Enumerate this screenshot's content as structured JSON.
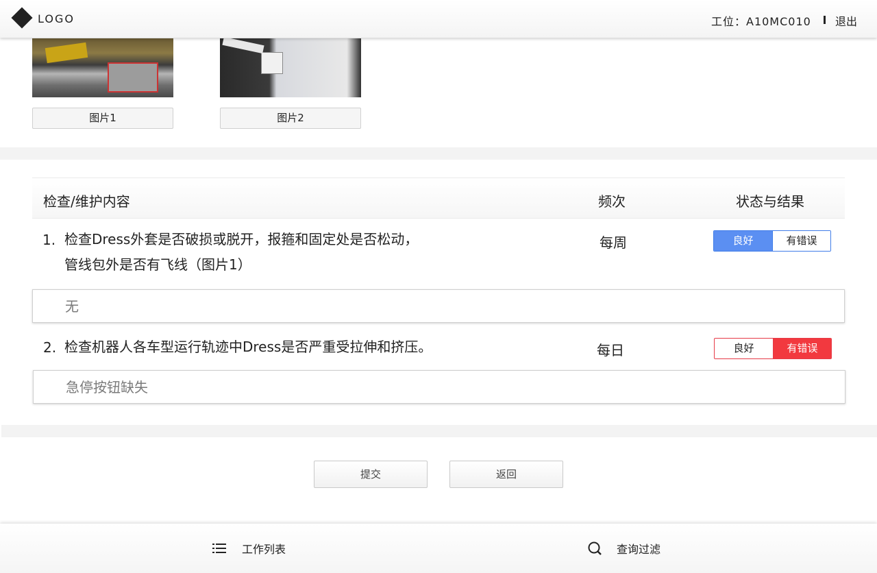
{
  "header": {
    "logo_text": "LOGO",
    "station_text": "工位：A10MC010",
    "logout_label": "退出"
  },
  "images": [
    {
      "label": "图片1"
    },
    {
      "label": "图片2"
    }
  ],
  "table": {
    "col_content": "检查/维护内容",
    "col_freq": "频次",
    "col_status": "状态与结果"
  },
  "items": [
    {
      "num": "1.",
      "line1": "检查Dress外套是否破损或脱开，报箍和固定处是否松动，",
      "line2": "管线包外是否有飞线（图片1）",
      "freq": "每周",
      "good_label": "良好",
      "error_label": "有错误",
      "selected": "良好",
      "remark": "无"
    },
    {
      "num": "2.",
      "line1": "检查机器人各车型运行轨迹中Dress是否严重受拉伸和挤压。",
      "freq": "每日",
      "good_label": "良好",
      "error_label": "有错误",
      "selected": "有错误",
      "remark": "急停按钮缺失"
    }
  ],
  "actions": {
    "submit_label": "提交",
    "back_label": "返回"
  },
  "bottom_nav": {
    "work_list_label": "工作列表",
    "work_list_icon": "list-icon",
    "query_filter_label": "查询过滤",
    "query_filter_icon": "search-icon"
  },
  "colors": {
    "selected_good": "#5b8ff2",
    "selected_error": "#f2393f"
  }
}
